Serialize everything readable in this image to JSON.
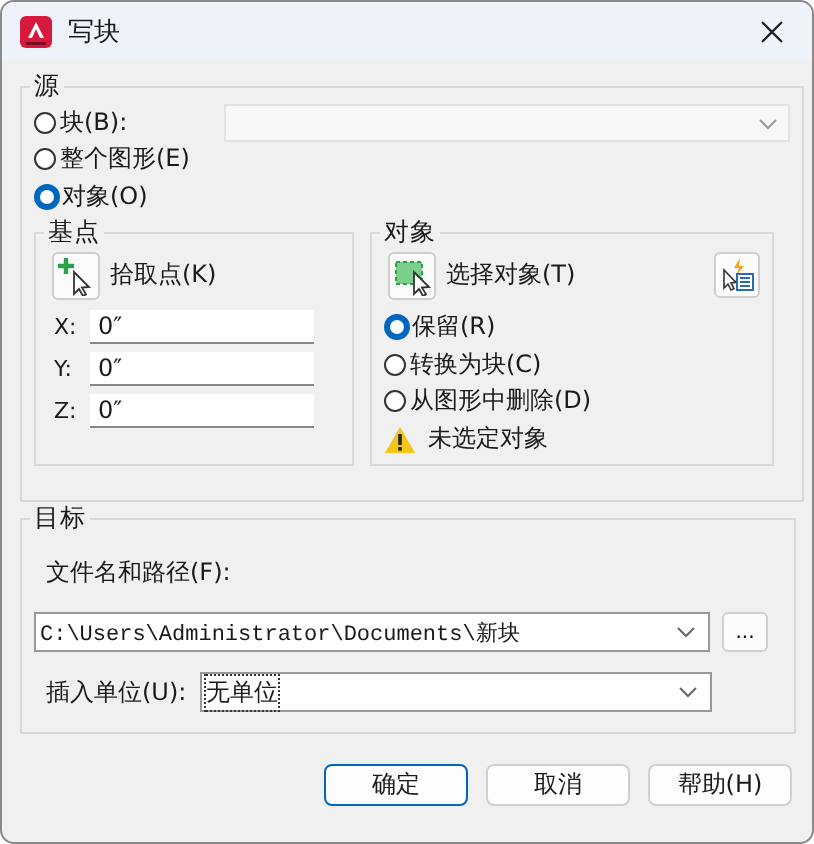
{
  "window": {
    "title": "写块"
  },
  "source": {
    "label": "源",
    "options": [
      {
        "label": "块(B):",
        "selected": false
      },
      {
        "label": "整个图形(E)",
        "selected": false
      },
      {
        "label": "对象(O)",
        "selected": true
      }
    ],
    "block_combo": {
      "disabled": true
    }
  },
  "base_point": {
    "label": "基点",
    "pick_button": "拾取点(K)",
    "fields": [
      {
        "label": "X:",
        "value": "0″"
      },
      {
        "label": "Y:",
        "value": "0″"
      },
      {
        "label": "Z:",
        "value": "0″"
      }
    ]
  },
  "objects": {
    "label": "对象",
    "select_button": "选择对象(T)",
    "options": [
      {
        "label": "保留(R)",
        "selected": true
      },
      {
        "label": "转换为块(C)",
        "selected": false
      },
      {
        "label": "从图形中删除(D)",
        "selected": false
      }
    ],
    "warning": "未选定对象"
  },
  "target": {
    "label": "目标",
    "path_label": "文件名和路径(F):",
    "path": "C:\\Users\\Administrator\\Documents\\新块",
    "browse_button": "...",
    "units_label": "插入单位(U):",
    "units": "无单位"
  },
  "buttons": [
    {
      "label": "确定",
      "default": true
    },
    {
      "label": "取消",
      "default": false
    },
    {
      "label": "帮助(H)",
      "default": false
    }
  ]
}
